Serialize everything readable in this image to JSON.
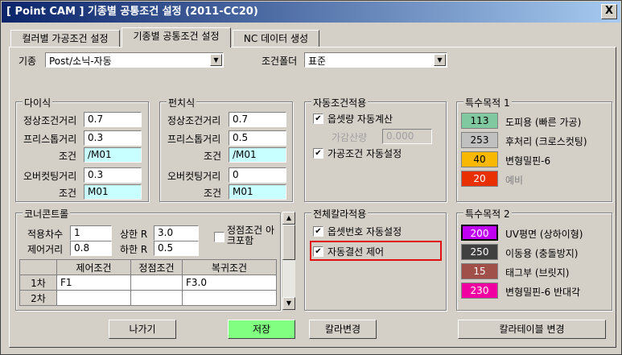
{
  "window": {
    "title": "[ Point CAM ]   기종별 공통조건 설정   (2011-CC20)",
    "close_label": "X"
  },
  "tabs": [
    {
      "label": "컬러별 가공조건 설정"
    },
    {
      "label": "기종별 공통조건 설정"
    },
    {
      "label": "NC 데이터 생성"
    }
  ],
  "top": {
    "model_label": "기종",
    "model_value": "Post/소닉-자동",
    "folder_label": "조건폴더",
    "folder_value": "표준"
  },
  "dies": {
    "title": "다이식",
    "normal_label": "정상조건거리",
    "normal_value": "0.7",
    "free_label": "프리스톱거리",
    "free_value": "0.3",
    "cond1_label": "조건",
    "cond1_value": "/M01",
    "over_label": "오버컷팅거리",
    "over_value": "0.3",
    "cond2_label": "조건",
    "cond2_value": "M01"
  },
  "punch": {
    "title": "펀치식",
    "normal_label": "정상조건거리",
    "normal_value": "0.7",
    "free_label": "프리스톱거리",
    "free_value": "0.5",
    "cond1_label": "조건",
    "cond1_value": "/M01",
    "over_label": "오버컷팅거리",
    "over_value": "0",
    "cond2_label": "조건",
    "cond2_value": "M01"
  },
  "auto": {
    "title": "자동조건적용",
    "offset_auto_label": "옵셋량 자동계산",
    "offset_auto_checked": "✔",
    "add_label": "가감산량",
    "add_value": "0.000",
    "proc_auto_label": "가공조건 자동설정",
    "proc_auto_checked": "✔"
  },
  "special1": {
    "title": "특수목적 1",
    "items": [
      {
        "value": "113",
        "label": "도피용 (빠른 가공)",
        "color": "#80c8a0"
      },
      {
        "value": "253",
        "label": "후처리 (크로스컷팅)",
        "color": "#c0c0c0"
      },
      {
        "value": "40",
        "label": "변형밀핀-6",
        "color": "#f8b800"
      },
      {
        "value": "20",
        "label": "예비",
        "color": "#e83000"
      }
    ]
  },
  "corner": {
    "title": "코너콘트롤",
    "apply_label": "적용차수",
    "apply_value": "1",
    "upper_label": "상한 R",
    "upper_value": "3.0",
    "ctrl_label": "제어거리",
    "ctrl_value": "0.8",
    "lower_label": "하한 R",
    "lower_value": "0.5",
    "arc_label": "정점조건 아크포함",
    "arc_checked": "",
    "headers": [
      "",
      "제어조건",
      "정점조건",
      "복귀조건"
    ],
    "rows": [
      [
        "1차",
        "F1",
        "",
        "F3.0"
      ],
      [
        "2차",
        "",
        "",
        ""
      ]
    ]
  },
  "color_apply": {
    "title": "전체칼라적용",
    "offset_num_label": "옵셋번호 자동설정",
    "offset_num_checked": "✔",
    "auto_wire_label": "자동결선 제어",
    "auto_wire_checked": "✔"
  },
  "special2": {
    "title": "특수목적 2",
    "items": [
      {
        "value": "200",
        "label": "UV평면 (상하이형)",
        "color": "#c000f0"
      },
      {
        "value": "250",
        "label": "이동용 (충돌방지)",
        "color": "#404040"
      },
      {
        "value": "15",
        "label": "태그부 (브릿지)",
        "color": "#a05048"
      },
      {
        "value": "230",
        "label": "변형밀핀-6 반대각",
        "color": "#f000a0"
      }
    ]
  },
  "buttons": {
    "exit": "나가기",
    "save": "저장",
    "color_change": "칼라변경",
    "color_table": "칼라테이블 변경"
  },
  "colors": {
    "save_button": "#80ff80",
    "highlight_box": "#e01010"
  }
}
